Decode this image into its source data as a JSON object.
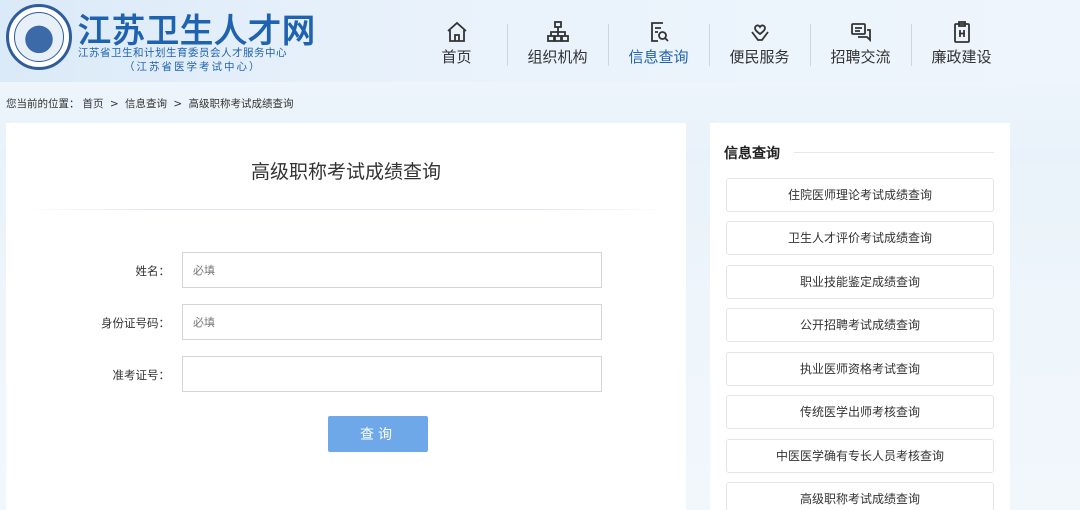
{
  "header": {
    "title": "江苏卫生人才网",
    "subtitle_line1": "江苏省卫生和计划生育委员会人才服务中心",
    "subtitle_line2": "（江苏省医学考试中心）"
  },
  "nav": {
    "items": [
      {
        "label": "首页",
        "icon": "home-icon"
      },
      {
        "label": "组织机构",
        "icon": "org-chart-icon"
      },
      {
        "label": "信息查询",
        "icon": "search-document-icon"
      },
      {
        "label": "便民服务",
        "icon": "heart-hands-icon"
      },
      {
        "label": "招聘交流",
        "icon": "chat-icon"
      },
      {
        "label": "廉政建设",
        "icon": "clipboard-icon"
      }
    ],
    "active_index": 2
  },
  "breadcrumb": {
    "prefix": "您当前的位置：",
    "home": "首页",
    "sep1": ">",
    "section": "信息查询",
    "sep2": ">",
    "current": "高级职称考试成绩查询"
  },
  "main": {
    "title": "高级职称考试成绩查询",
    "form": {
      "name_label": "姓名：",
      "name_placeholder": "必填",
      "id_label": "身份证号码：",
      "id_placeholder": "必填",
      "ticket_label": "准考证号：",
      "ticket_placeholder": "",
      "submit_label": "查询"
    }
  },
  "sidebar": {
    "title": "信息查询",
    "items": [
      {
        "label": "住院医师理论考试成绩查询"
      },
      {
        "label": "卫生人才评价考试成绩查询"
      },
      {
        "label": "职业技能鉴定成绩查询"
      },
      {
        "label": "公开招聘考试成绩查询"
      },
      {
        "label": "执业医师资格考试查询"
      },
      {
        "label": "传统医学出师考核查询"
      },
      {
        "label": "中医医学确有专长人员考核查询"
      },
      {
        "label": "高级职称考试成绩查询"
      }
    ]
  },
  "colors": {
    "brand": "#1f62b0",
    "button": "#6ea8e8"
  }
}
